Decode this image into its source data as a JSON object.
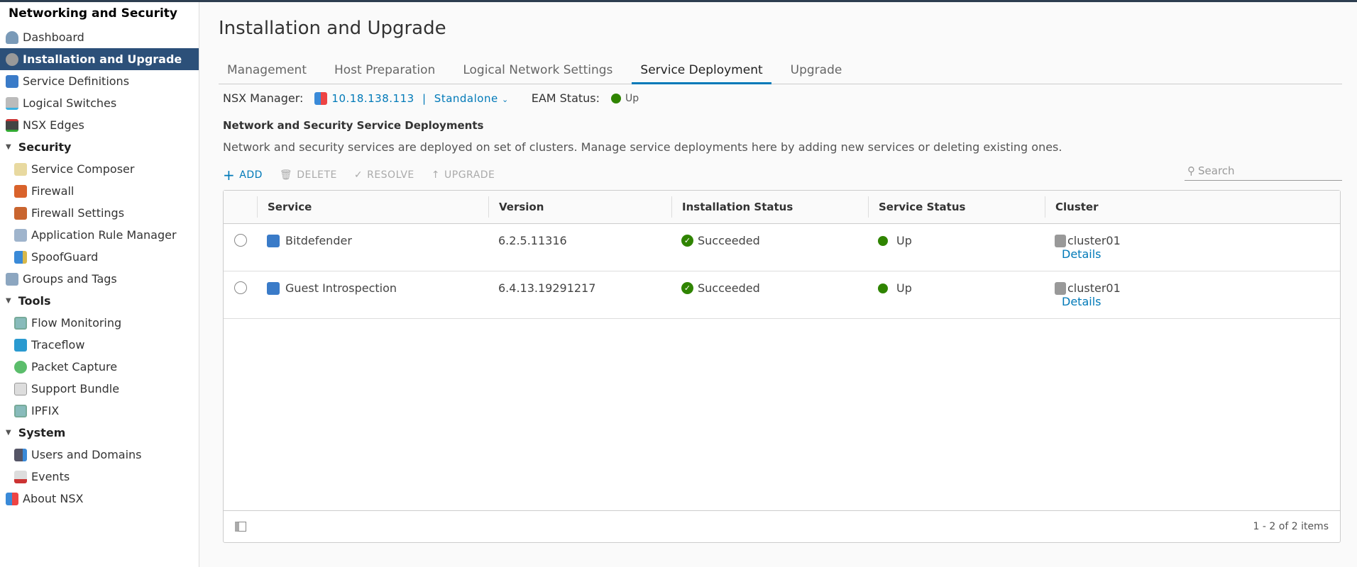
{
  "sidebar": {
    "title": "Networking and Security",
    "items": [
      {
        "label": "Dashboard"
      },
      {
        "label": "Installation and Upgrade"
      },
      {
        "label": "Service Definitions"
      },
      {
        "label": "Logical Switches"
      },
      {
        "label": "NSX Edges"
      }
    ],
    "security": {
      "label": "Security",
      "items": [
        {
          "label": "Service Composer"
        },
        {
          "label": "Firewall"
        },
        {
          "label": "Firewall Settings"
        },
        {
          "label": "Application Rule Manager"
        },
        {
          "label": "SpoofGuard"
        }
      ]
    },
    "groups": "Groups and Tags",
    "tools": {
      "label": "Tools",
      "items": [
        {
          "label": "Flow Monitoring"
        },
        {
          "label": "Traceflow"
        },
        {
          "label": "Packet Capture"
        },
        {
          "label": "Support Bundle"
        },
        {
          "label": "IPFIX"
        }
      ]
    },
    "system": {
      "label": "System",
      "items": [
        {
          "label": "Users and Domains"
        },
        {
          "label": "Events"
        }
      ]
    },
    "about": "About NSX"
  },
  "page": {
    "title": "Installation and Upgrade",
    "tabs": [
      "Management",
      "Host Preparation",
      "Logical Network Settings",
      "Service Deployment",
      "Upgrade"
    ],
    "nsx_manager_label": "NSX Manager:",
    "nsx_manager_ip": "10.18.138.113",
    "nsx_manager_sep": "|",
    "nsx_manager_role": "Standalone",
    "eam_label": "EAM Status:",
    "eam_value": "Up",
    "section_title": "Network and Security Service Deployments",
    "section_desc": "Network and security services are deployed on set of clusters. Manage service deployments here by adding new services or deleting existing ones.",
    "toolbar": {
      "add": "ADD",
      "delete": "DELETE",
      "resolve": "RESOLVE",
      "upgrade": "UPGRADE"
    },
    "search_placeholder": "Search"
  },
  "grid": {
    "columns": [
      "Service",
      "Version",
      "Installation Status",
      "Service Status",
      "Cluster"
    ],
    "rows": [
      {
        "service": "Bitdefender",
        "version": "6.2.5.11316",
        "install": "Succeeded",
        "status": "Up",
        "cluster": "cluster01",
        "details": "Details"
      },
      {
        "service": "Guest Introspection",
        "version": "6.4.13.19291217",
        "install": "Succeeded",
        "status": "Up",
        "cluster": "cluster01",
        "details": "Details"
      }
    ],
    "footer": "1 - 2 of 2 items"
  },
  "colors": {
    "accent": "#0079b8",
    "active_nav": "#2c5079",
    "ok": "#2f8400"
  }
}
